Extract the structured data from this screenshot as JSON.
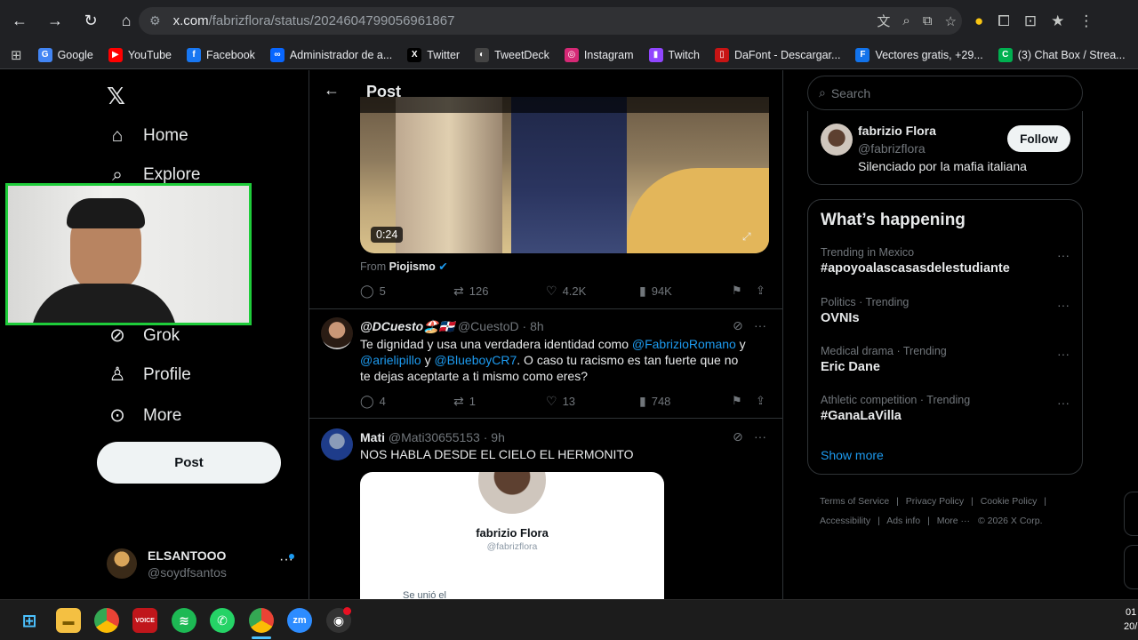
{
  "browser": {
    "url_host": "x.com",
    "url_path": "/fabrizflora/status/2024604799056961867",
    "bookmarks": [
      {
        "label": "Google",
        "color": "#4285f4",
        "glyph": "G"
      },
      {
        "label": "YouTube",
        "color": "#ff0000",
        "glyph": "▶"
      },
      {
        "label": "Facebook",
        "color": "#1877f2",
        "glyph": "f"
      },
      {
        "label": "Administrador de a...",
        "color": "#0866ff",
        "glyph": "∞"
      },
      {
        "label": "Twitter",
        "color": "#000000",
        "glyph": "X"
      },
      {
        "label": "TweetDeck",
        "color": "#444444",
        "glyph": "◐"
      },
      {
        "label": "Instagram",
        "color": "#d62976",
        "glyph": "◎"
      },
      {
        "label": "Twitch",
        "color": "#9146ff",
        "glyph": "▮"
      },
      {
        "label": "DaFont - Descargar...",
        "color": "#c81414",
        "glyph": "▯"
      },
      {
        "label": "Vectores gratis, +29...",
        "color": "#1273eb",
        "glyph": "F"
      },
      {
        "label": "(3) Chat Box / Strea...",
        "color": "#00b050",
        "glyph": "C"
      }
    ]
  },
  "sidebar": {
    "home": "Home",
    "explore": "Explore",
    "grok": "Grok",
    "profile": "Profile",
    "more": "More",
    "post_button": "Post",
    "account_name": "ELSANTOOO",
    "account_handle": "@soydfsantos"
  },
  "header": {
    "title": "Post"
  },
  "main_tweet": {
    "video_duration": "0:24",
    "from_label": "From",
    "from_name": "Piojismo",
    "replies": "5",
    "reposts": "126",
    "likes": "4.2K",
    "views": "94K"
  },
  "reply1": {
    "name": "@DCuesto🏖️🇩🇴",
    "handle": "@CuestoD",
    "time": "8h",
    "text_a": "Te dignidad y usa una verdadera identidad como ",
    "mention_a": "@FabrizioRomano",
    "text_b": " y ",
    "mention_b": "@arielipillo",
    "text_c": " y ",
    "mention_c": "@BlueboyCR7",
    "text_d": ". O caso tu racismo es tan fuerte que no te dejas aceptarte a ti mismo como eres?",
    "replies": "4",
    "reposts": "1",
    "likes": "13",
    "views": "748"
  },
  "reply2": {
    "name": "Mati",
    "handle": "@Mati30655153",
    "time": "9h",
    "text": "NOS HABLA DESDE EL CIELO EL HERMONITO",
    "card_name": "fabrizio Flora",
    "card_handle": "@fabrizflora",
    "card_joined": "Se unió el"
  },
  "search": {
    "placeholder": "Search"
  },
  "profile_card": {
    "name": "fabrizio Flora",
    "handle": "@fabrizflora",
    "bio": "Silenciado por la mafia italiana",
    "follow": "Follow"
  },
  "whats_happening": {
    "title": "What’s happening",
    "trends": [
      {
        "category": "Trending in Mexico",
        "name": "#apoyoalascasasdelestudiante"
      },
      {
        "category": "Politics · Trending",
        "name": "OVNIs"
      },
      {
        "category": "Medical drama · Trending",
        "name": "Eric Dane"
      },
      {
        "category": "Athletic competition · Trending",
        "name": "#GanaLaVilla"
      }
    ],
    "show_more": "Show more"
  },
  "footer": {
    "terms": "Terms of Service",
    "privacy": "Privacy Policy",
    "cookie": "Cookie Policy",
    "accessibility": "Accessibility",
    "ads": "Ads info",
    "more": "More ···",
    "copyright": "© 2026 X Corp."
  },
  "taskbar": {
    "clock_time": "01",
    "clock_date": "20/"
  }
}
